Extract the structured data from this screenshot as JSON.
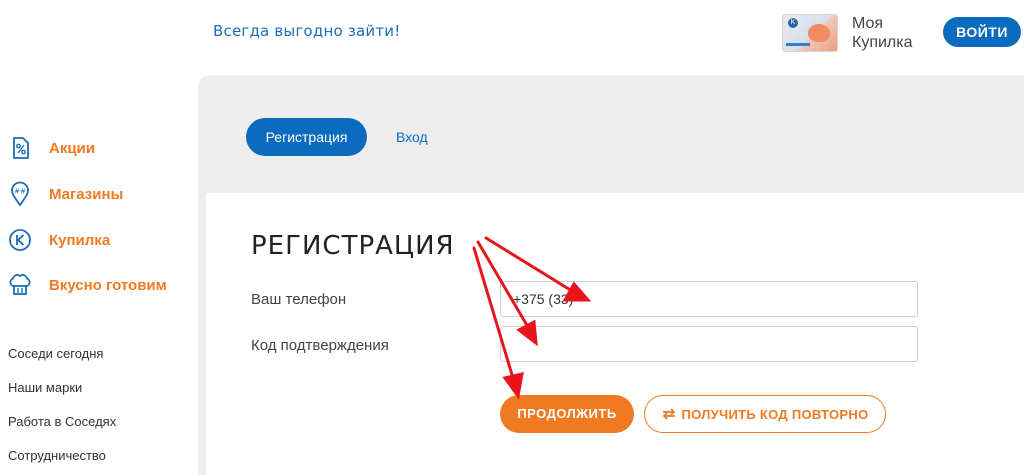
{
  "header": {
    "tagline": "Всегда выгодно зайти!",
    "card_name": "Моя Купилка",
    "login_button": "ВОЙТИ"
  },
  "sidebar": {
    "main_items": [
      {
        "label": "Акции",
        "icon": "percent-tag-icon"
      },
      {
        "label": "Магазины",
        "icon": "map-pin-icon"
      },
      {
        "label": "Купилка",
        "icon": "k-circle-icon"
      },
      {
        "label": "Вкусно готовим",
        "icon": "chef-hat-icon"
      }
    ],
    "links": [
      "Соседи сегодня",
      "Наши марки",
      "Работа в Соседях",
      "Сотрудничество"
    ]
  },
  "tabs": {
    "register": "Регистрация",
    "login": "Вход"
  },
  "form": {
    "title": "РЕГИСТРАЦИЯ",
    "phone_label": "Ваш телефон",
    "phone_value": "+375 (33)",
    "code_label": "Код подтверждения",
    "code_value": "",
    "continue_button": "ПРОДОЛЖИТЬ",
    "resend_button": "ПОЛУЧИТЬ КОД ПОВТОРНО"
  },
  "colors": {
    "brand_blue": "#0b6cbf",
    "accent_orange": "#f07a22",
    "annotation_red": "#e8141b"
  }
}
